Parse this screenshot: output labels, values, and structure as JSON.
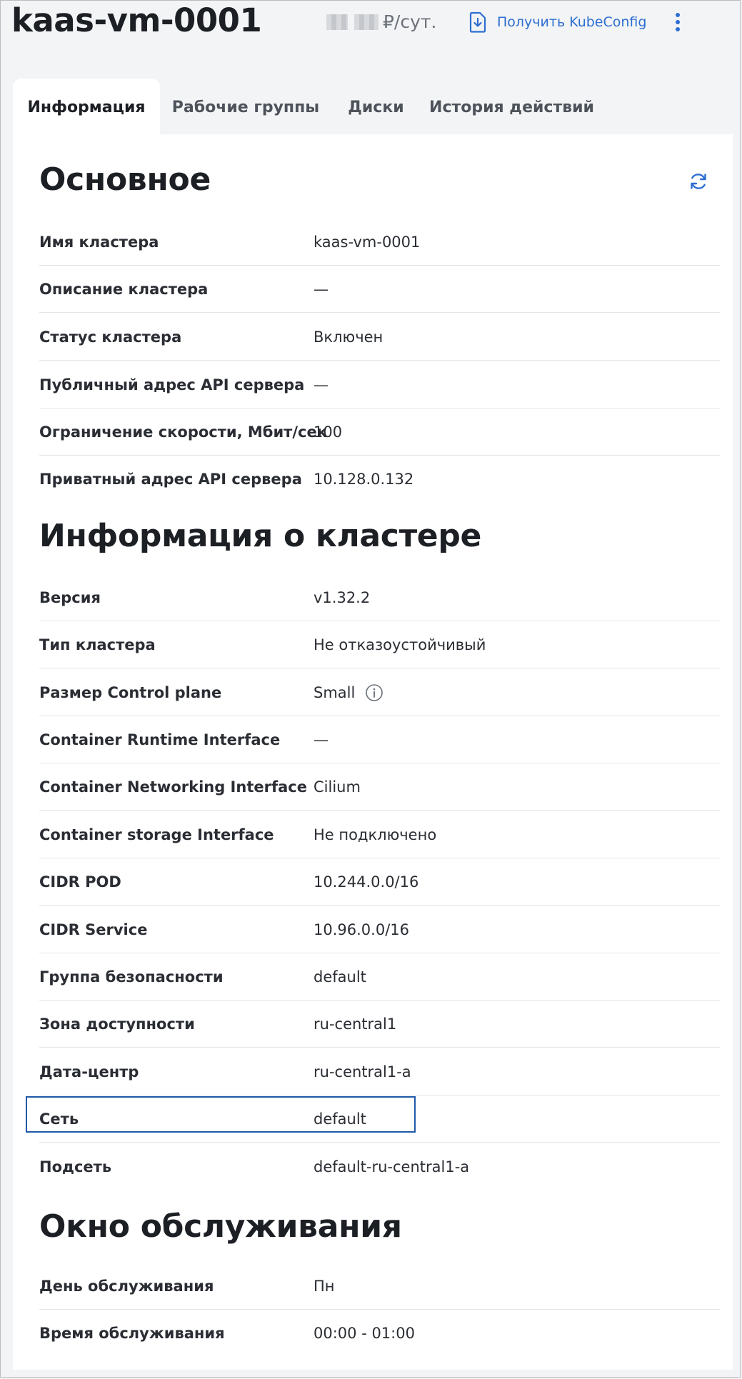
{
  "header": {
    "title": "kaas-vm-0001",
    "price_suffix": "₽/сут.",
    "kubeconfig_label": "Получить KubeConfig",
    "icons": {
      "download": "download-icon",
      "more": "more-vertical-icon"
    }
  },
  "tabs": [
    {
      "label": "Информация",
      "active": true
    },
    {
      "label": "Рабочие группы",
      "active": false
    },
    {
      "label": "Диски",
      "active": false
    },
    {
      "label": "История действий",
      "active": false
    }
  ],
  "sections": {
    "main": {
      "title": "Основное",
      "rows": [
        {
          "label": "Имя кластера",
          "value": "kaas-vm-0001"
        },
        {
          "label": "Описание кластера",
          "value": "—"
        },
        {
          "label": "Статус кластера",
          "value": "Включен"
        },
        {
          "label": "Публичный адрес API сервера",
          "value": "—"
        },
        {
          "label": "Ограничение скорости, Мбит/сек",
          "value": "100"
        },
        {
          "label": "Приватный адрес API сервера",
          "value": "10.128.0.132"
        }
      ]
    },
    "cluster": {
      "title": "Информация о кластере",
      "rows": [
        {
          "label": "Версия",
          "value": "v1.32.2"
        },
        {
          "label": "Тип кластера",
          "value": "Не отказоустойчивый"
        },
        {
          "label": "Размер Control plane",
          "value": "Small"
        },
        {
          "label": "Container Runtime Interface",
          "value": "—"
        },
        {
          "label": "Container Networking Interface",
          "value": "Cilium"
        },
        {
          "label": "Container storage Interface",
          "value": "Не подключено"
        },
        {
          "label": "CIDR POD",
          "value": "10.244.0.0/16"
        },
        {
          "label": "CIDR Service",
          "value": "10.96.0.0/16"
        },
        {
          "label": "Группа безопасности",
          "value": "default"
        },
        {
          "label": "Зона доступности",
          "value": "ru-central1"
        },
        {
          "label": "Дата-центр",
          "value": "ru-central1-a"
        },
        {
          "label": "Сеть",
          "value": "default"
        },
        {
          "label": "Подсеть",
          "value": "default-ru-central1-a"
        }
      ]
    },
    "maintenance": {
      "title": "Окно обслуживания",
      "rows": [
        {
          "label": "День обслуживания",
          "value": "Пн"
        },
        {
          "label": "Время обслуживания",
          "value": "00:00 - 01:00"
        }
      ]
    }
  },
  "colors": {
    "accent": "#2d6ed1",
    "focus": "#1e59a8",
    "background": "#f3f4f6",
    "panel": "#ffffff"
  }
}
